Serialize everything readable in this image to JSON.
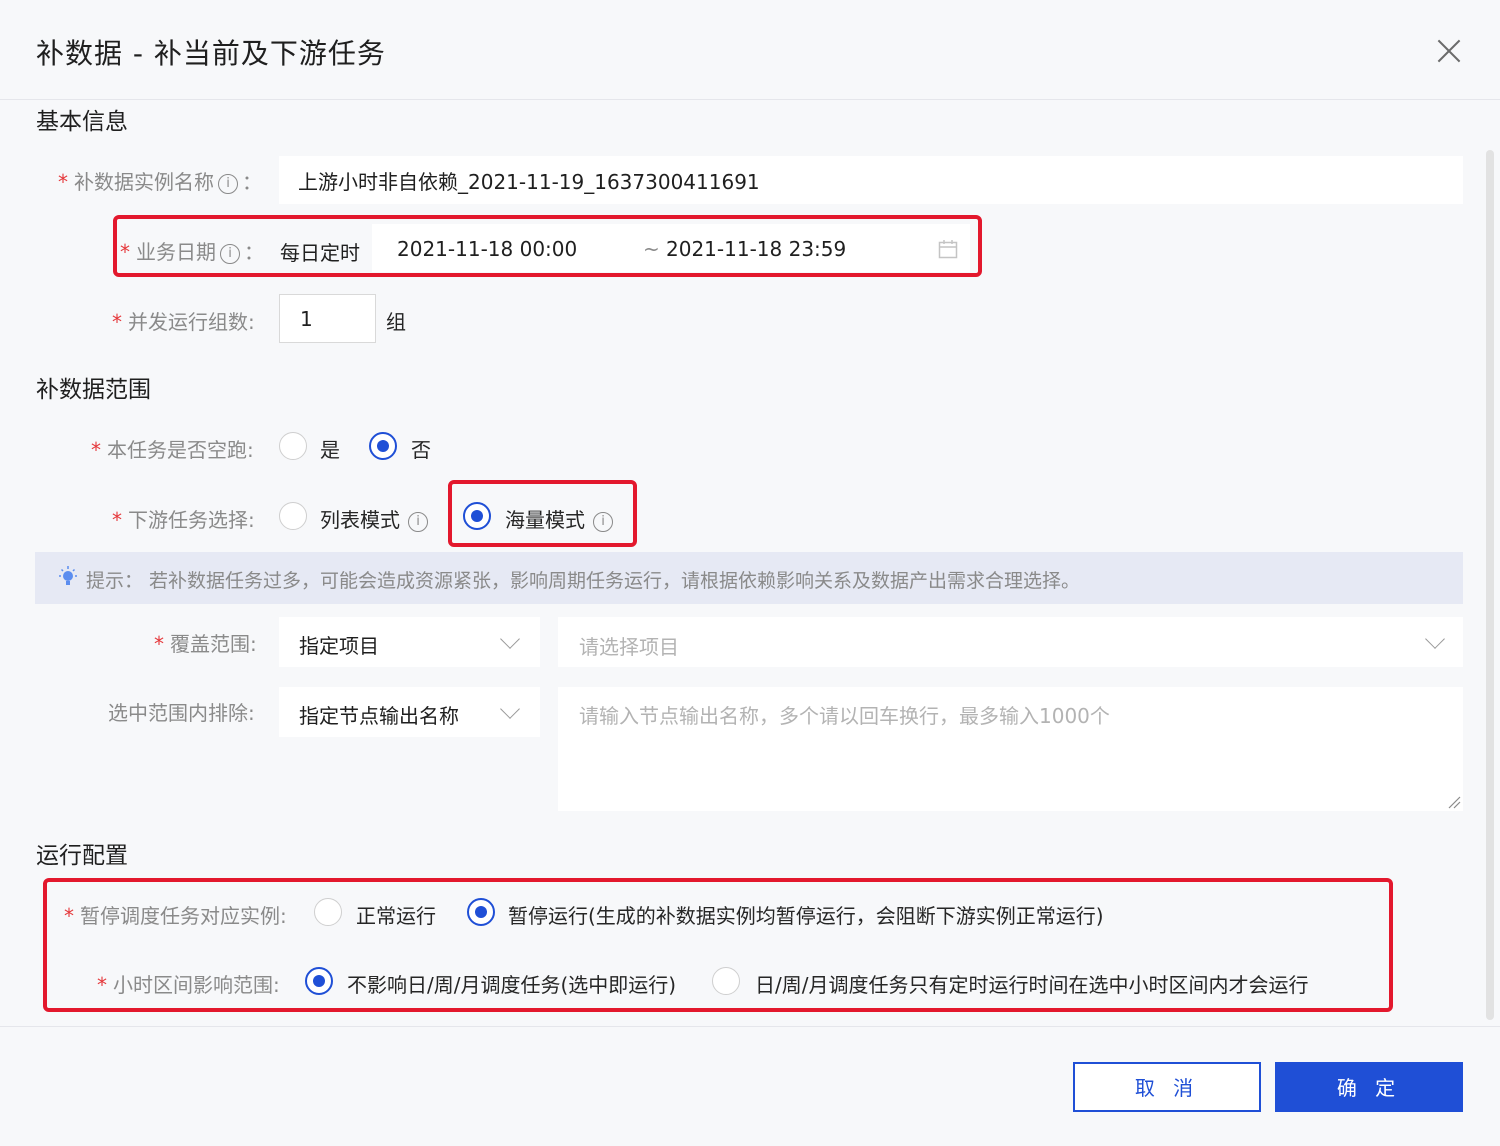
{
  "dialog": {
    "title": "补数据 - 补当前及下游任务"
  },
  "basic": {
    "section_title": "基本信息",
    "instance_name_label": "补数据实例名称",
    "instance_name_value": "上游小时非自依赖_2021-11-19_1637300411691",
    "biz_date_label": "业务日期",
    "schedule_type": "每日定时",
    "date_start": "2021-11-18 00:00",
    "date_sep": "~",
    "date_end": "2021-11-18 23:59",
    "concurrency_label": "并发运行组数:",
    "concurrency_value": "1",
    "concurrency_unit": "组",
    "colon": "："
  },
  "scope": {
    "section_title": "补数据范围",
    "dry_run_label": "本任务是否空跑:",
    "dry_run_yes": "是",
    "dry_run_no": "否",
    "dry_run_selected": "否",
    "downstream_label": "下游任务选择:",
    "mode_list": "列表模式",
    "mode_mass": "海量模式",
    "mode_selected": "海量模式",
    "tip": "提示： 若补数据任务过多，可能会造成资源紧张，影响周期任务运行，请根据依赖影响关系及数据产出需求合理选择。",
    "coverage_label": "覆盖范围:",
    "coverage_value": "指定项目",
    "project_placeholder": "请选择项目",
    "exclude_label": "选中范围内排除:",
    "exclude_value": "指定节点输出名称",
    "exclude_placeholder": "请输入节点输出名称，多个请以回车换行，最多输入1000个"
  },
  "run": {
    "section_title": "运行配置",
    "pause_label": "暂停调度任务对应实例:",
    "pause_normal": "正常运行",
    "pause_paused": "暂停运行(生成的补数据实例均暂停运行，会阻断下游实例正常运行)",
    "pause_selected": "暂停运行",
    "hour_label": "小时区间影响范围:",
    "hour_opt1": "不影响日/周/月调度任务(选中即运行)",
    "hour_opt2": "日/周/月调度任务只有定时运行时间在选中小时区间内才会运行",
    "hour_selected": "不影响日/周/月调度任务(选中即运行)"
  },
  "footer": {
    "cancel": "取 消",
    "ok": "确 定"
  },
  "colors": {
    "primary": "#1f4fd6",
    "highlight": "#e3182d",
    "required": "#e5383b"
  },
  "icons": {
    "close": "close-icon",
    "info": "info-icon",
    "calendar": "calendar-icon",
    "bulb": "bulb-icon",
    "chevron": "chevron-down-icon"
  }
}
